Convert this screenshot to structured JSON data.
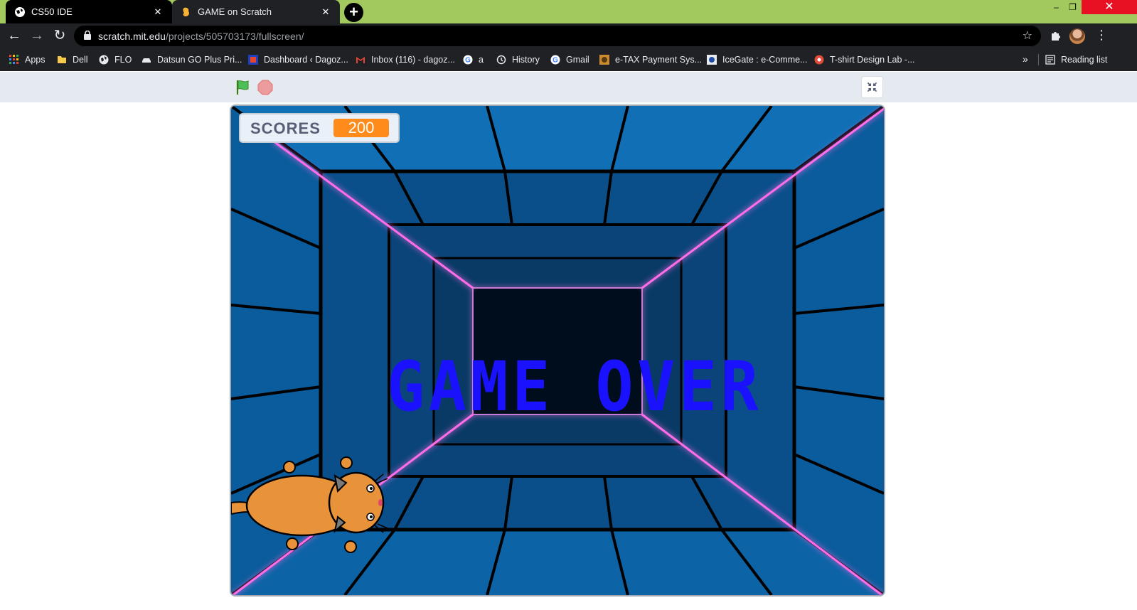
{
  "browser": {
    "tabs": [
      {
        "title": "CS50 IDE",
        "icon": "globe-icon",
        "active": false
      },
      {
        "title": "GAME on Scratch",
        "icon": "scratch-icon",
        "active": true
      }
    ],
    "new_tab_icon": "plus-icon",
    "url": {
      "host": "scratch.mit.edu",
      "path": "/projects/505703173/fullscreen/"
    },
    "window_controls": [
      "minimize",
      "restore",
      "close"
    ]
  },
  "bookmarks": [
    {
      "label": "Apps",
      "icon": "apps-grid-icon"
    },
    {
      "label": "Dell",
      "icon": "folder-icon"
    },
    {
      "label": "FLO",
      "icon": "globe-icon"
    },
    {
      "label": "Datsun GO Plus Pri...",
      "icon": "car-icon"
    },
    {
      "label": "Dashboard ‹ Dagoz...",
      "icon": "site-icon"
    },
    {
      "label": "Inbox (116) - dagoz...",
      "icon": "gmail-icon"
    },
    {
      "label": "a",
      "icon": "google-icon"
    },
    {
      "label": "History",
      "icon": "history-icon"
    },
    {
      "label": "Gmail",
      "icon": "google-icon"
    },
    {
      "label": "e-TAX Payment Sys...",
      "icon": "site-icon"
    },
    {
      "label": "IceGate : e-Comme...",
      "icon": "emblem-icon"
    },
    {
      "label": "T-shirt Design Lab -...",
      "icon": "flower-icon"
    }
  ],
  "bookmarks_more": "»",
  "reading_list": "Reading list",
  "scratch": {
    "score_label": "SCORES",
    "score_value": "200",
    "game_over_text": "GAME OVER"
  },
  "colors": {
    "tab_strip": "#a2c95d",
    "score_badge": "#ff8c1a",
    "game_over": "#1a12ff",
    "stage_blue": "#0f5b9c"
  }
}
